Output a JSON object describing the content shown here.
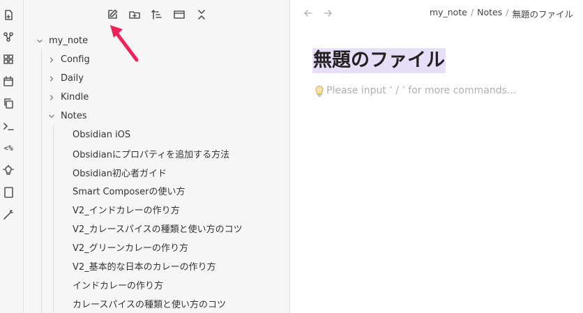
{
  "ribbon": {
    "icons": [
      "file-switch-icon",
      "graph-icon",
      "canvas-icon",
      "calendar-icon",
      "copy-icon",
      "terminal-icon",
      "template-icon",
      "lightbulb-icon",
      "book-icon",
      "magic-wand-icon"
    ],
    "template_label": "<%"
  },
  "sidebar": {
    "toolbar": [
      "new-note-icon",
      "new-folder-icon",
      "sort-icon",
      "collapse-view-icon",
      "collapse-all-icon"
    ],
    "tree": {
      "root": "my_note",
      "folders": [
        "Config",
        "Daily",
        "Kindle",
        "Notes"
      ],
      "notes": [
        "Obsidian iOS",
        "Obsidianにプロパティを追加する方法",
        "Obsidian初心者ガイド",
        "Smart Composerの使い方",
        "V2_インドカレーの作り方",
        "V2_カレースパイスの種類と使い方のコツ",
        "V2_グリーンカレーの作り方",
        "V2_基本的な日本のカレーの作り方",
        "インドカレーの作り方",
        "カレースパイスの種類と使い方のコツ"
      ]
    }
  },
  "main": {
    "breadcrumb": [
      "my_note",
      "Notes",
      "無題のファイル"
    ],
    "separator": "/",
    "title": "無題のファイル",
    "placeholder": "Please input ‘ / ’ for more commands..."
  },
  "colors": {
    "title_highlight": "#e7def7",
    "annotation_arrow": "#f0215a",
    "sidebar_bg": "#f6f6f6"
  }
}
